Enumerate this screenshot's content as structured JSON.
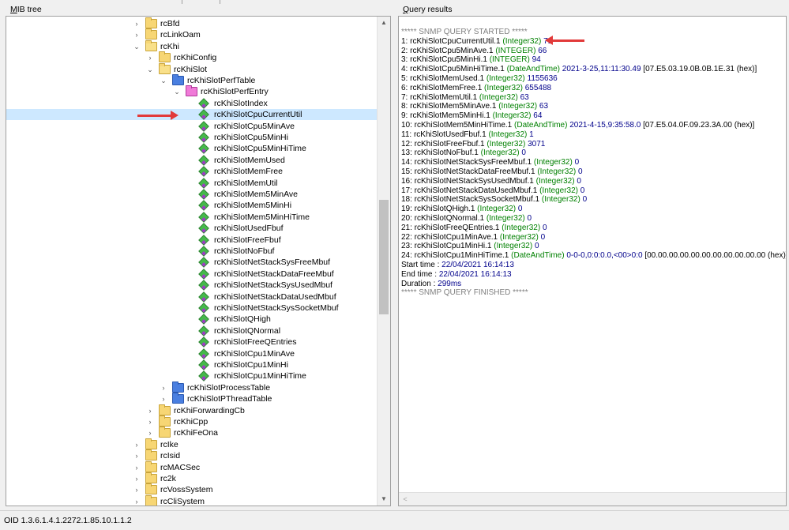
{
  "panels": {
    "mib_label": "MIB tree",
    "mib_label_accel": "M",
    "mib_label_rest": "IB tree",
    "results_label": "Query results",
    "results_label_accel": "Q",
    "results_label_rest": "uery results"
  },
  "tree": {
    "rows": [
      {
        "label": "rcBfd",
        "level": 0,
        "icon": "folder-closed",
        "expander": "collapsed"
      },
      {
        "label": "rcLinkOam",
        "level": 0,
        "icon": "folder-closed",
        "expander": "collapsed"
      },
      {
        "label": "rcKhi",
        "level": 0,
        "icon": "folder-open",
        "expander": "expanded"
      },
      {
        "label": "rcKhiConfig",
        "level": 1,
        "icon": "folder-closed",
        "expander": "collapsed"
      },
      {
        "label": "rcKhiSlot",
        "level": 1,
        "icon": "folder-open",
        "expander": "expanded"
      },
      {
        "label": "rcKhiSlotPerfTable",
        "level": 2,
        "icon": "table-folder",
        "expander": "expanded"
      },
      {
        "label": "rcKhiSlotPerfEntry",
        "level": 3,
        "icon": "entry-folder",
        "expander": "expanded"
      },
      {
        "label": "rcKhiSlotIndex",
        "level": 4,
        "icon": "leaf-object",
        "expander": "none"
      },
      {
        "label": "rcKhiSlotCpuCurrentUtil",
        "level": 4,
        "icon": "leaf-object",
        "expander": "none",
        "selected": true
      },
      {
        "label": "rcKhiSlotCpu5MinAve",
        "level": 4,
        "icon": "leaf-object",
        "expander": "none"
      },
      {
        "label": "rcKhiSlotCpu5MinHi",
        "level": 4,
        "icon": "leaf-object",
        "expander": "none"
      },
      {
        "label": "rcKhiSlotCpu5MinHiTime",
        "level": 4,
        "icon": "leaf-object",
        "expander": "none"
      },
      {
        "label": "rcKhiSlotMemUsed",
        "level": 4,
        "icon": "leaf-object",
        "expander": "none"
      },
      {
        "label": "rcKhiSlotMemFree",
        "level": 4,
        "icon": "leaf-object",
        "expander": "none"
      },
      {
        "label": "rcKhiSlotMemUtil",
        "level": 4,
        "icon": "leaf-object",
        "expander": "none"
      },
      {
        "label": "rcKhiSlotMem5MinAve",
        "level": 4,
        "icon": "leaf-object",
        "expander": "none"
      },
      {
        "label": "rcKhiSlotMem5MinHi",
        "level": 4,
        "icon": "leaf-object",
        "expander": "none"
      },
      {
        "label": "rcKhiSlotMem5MinHiTime",
        "level": 4,
        "icon": "leaf-object",
        "expander": "none"
      },
      {
        "label": "rcKhiSlotUsedFbuf",
        "level": 4,
        "icon": "leaf-object",
        "expander": "none"
      },
      {
        "label": "rcKhiSlotFreeFbuf",
        "level": 4,
        "icon": "leaf-object",
        "expander": "none"
      },
      {
        "label": "rcKhiSlotNoFbuf",
        "level": 4,
        "icon": "leaf-object",
        "expander": "none"
      },
      {
        "label": "rcKhiSlotNetStackSysFreeMbuf",
        "level": 4,
        "icon": "leaf-object",
        "expander": "none"
      },
      {
        "label": "rcKhiSlotNetStackDataFreeMbuf",
        "level": 4,
        "icon": "leaf-object",
        "expander": "none"
      },
      {
        "label": "rcKhiSlotNetStackSysUsedMbuf",
        "level": 4,
        "icon": "leaf-object",
        "expander": "none"
      },
      {
        "label": "rcKhiSlotNetStackDataUsedMbuf",
        "level": 4,
        "icon": "leaf-object",
        "expander": "none"
      },
      {
        "label": "rcKhiSlotNetStackSysSocketMbuf",
        "level": 4,
        "icon": "leaf-object",
        "expander": "none"
      },
      {
        "label": "rcKhiSlotQHigh",
        "level": 4,
        "icon": "leaf-object",
        "expander": "none"
      },
      {
        "label": "rcKhiSlotQNormal",
        "level": 4,
        "icon": "leaf-object",
        "expander": "none"
      },
      {
        "label": "rcKhiSlotFreeQEntries",
        "level": 4,
        "icon": "leaf-object",
        "expander": "none"
      },
      {
        "label": "rcKhiSlotCpu1MinAve",
        "level": 4,
        "icon": "leaf-object",
        "expander": "none"
      },
      {
        "label": "rcKhiSlotCpu1MinHi",
        "level": 4,
        "icon": "leaf-object",
        "expander": "none"
      },
      {
        "label": "rcKhiSlotCpu1MinHiTime",
        "level": 4,
        "icon": "leaf-object",
        "expander": "none"
      },
      {
        "label": "rcKhiSlotProcessTable",
        "level": 2,
        "icon": "table-folder",
        "expander": "collapsed"
      },
      {
        "label": "rcKhiSlotPThreadTable",
        "level": 2,
        "icon": "table-folder",
        "expander": "collapsed"
      },
      {
        "label": "rcKhiForwardingCb",
        "level": 1,
        "icon": "folder-closed",
        "expander": "collapsed"
      },
      {
        "label": "rcKhiCpp",
        "level": 1,
        "icon": "folder-closed",
        "expander": "collapsed"
      },
      {
        "label": "rcKhiFeOna",
        "level": 1,
        "icon": "folder-closed",
        "expander": "collapsed"
      },
      {
        "label": "rcIke",
        "level": 0,
        "icon": "folder-closed",
        "expander": "collapsed"
      },
      {
        "label": "rcIsid",
        "level": 0,
        "icon": "folder-closed",
        "expander": "collapsed"
      },
      {
        "label": "rcMACSec",
        "level": 0,
        "icon": "folder-closed",
        "expander": "collapsed"
      },
      {
        "label": "rc2k",
        "level": 0,
        "icon": "folder-closed",
        "expander": "collapsed"
      },
      {
        "label": "rcVossSystem",
        "level": 0,
        "icon": "folder-closed",
        "expander": "collapsed"
      },
      {
        "label": "rcCliSystem",
        "level": 0,
        "icon": "folder-closed",
        "expander": "collapsed"
      }
    ]
  },
  "results": {
    "started": "***** SNMP QUERY STARTED *****",
    "lines": [
      {
        "prefix": "1: rcKhiSlotCpuCurrentUtil.1",
        "type": "(Integer32)",
        "value": "71",
        "extra": ""
      },
      {
        "prefix": "2: rcKhiSlotCpu5MinAve.1",
        "type": "(INTEGER)",
        "value": "66",
        "extra": ""
      },
      {
        "prefix": "3: rcKhiSlotCpu5MinHi.1",
        "type": "(INTEGER)",
        "value": "94",
        "extra": ""
      },
      {
        "prefix": "4: rcKhiSlotCpu5MinHiTime.1",
        "type": "(DateAndTime)",
        "value": "2021-3-25,11:11:30.49",
        "extra": "[07.E5.03.19.0B.0B.1E.31 (hex)]"
      },
      {
        "prefix": "5: rcKhiSlotMemUsed.1",
        "type": "(Integer32)",
        "value": "1155636",
        "extra": ""
      },
      {
        "prefix": "6: rcKhiSlotMemFree.1",
        "type": "(Integer32)",
        "value": "655488",
        "extra": ""
      },
      {
        "prefix": "7: rcKhiSlotMemUtil.1",
        "type": "(Integer32)",
        "value": "63",
        "extra": ""
      },
      {
        "prefix": "8: rcKhiSlotMem5MinAve.1",
        "type": "(Integer32)",
        "value": "63",
        "extra": ""
      },
      {
        "prefix": "9: rcKhiSlotMem5MinHi.1",
        "type": "(Integer32)",
        "value": "64",
        "extra": ""
      },
      {
        "prefix": "10: rcKhiSlotMem5MinHiTime.1",
        "type": "(DateAndTime)",
        "value": "2021-4-15,9:35:58.0",
        "extra": "[07.E5.04.0F.09.23.3A.00 (hex)]"
      },
      {
        "prefix": "11: rcKhiSlotUsedFbuf.1",
        "type": "(Integer32)",
        "value": "1",
        "extra": ""
      },
      {
        "prefix": "12: rcKhiSlotFreeFbuf.1",
        "type": "(Integer32)",
        "value": "3071",
        "extra": ""
      },
      {
        "prefix": "13: rcKhiSlotNoFbuf.1",
        "type": "(Integer32)",
        "value": "0",
        "extra": ""
      },
      {
        "prefix": "14: rcKhiSlotNetStackSysFreeMbuf.1",
        "type": "(Integer32)",
        "value": "0",
        "extra": ""
      },
      {
        "prefix": "15: rcKhiSlotNetStackDataFreeMbuf.1",
        "type": "(Integer32)",
        "value": "0",
        "extra": ""
      },
      {
        "prefix": "16: rcKhiSlotNetStackSysUsedMbuf.1",
        "type": "(Integer32)",
        "value": "0",
        "extra": ""
      },
      {
        "prefix": "17: rcKhiSlotNetStackDataUsedMbuf.1",
        "type": "(Integer32)",
        "value": "0",
        "extra": ""
      },
      {
        "prefix": "18: rcKhiSlotNetStackSysSocketMbuf.1",
        "type": "(Integer32)",
        "value": "0",
        "extra": ""
      },
      {
        "prefix": "19: rcKhiSlotQHigh.1",
        "type": "(Integer32)",
        "value": "0",
        "extra": ""
      },
      {
        "prefix": "20: rcKhiSlotQNormal.1",
        "type": "(Integer32)",
        "value": "0",
        "extra": ""
      },
      {
        "prefix": "21: rcKhiSlotFreeQEntries.1",
        "type": "(Integer32)",
        "value": "0",
        "extra": ""
      },
      {
        "prefix": "22: rcKhiSlotCpu1MinAve.1",
        "type": "(Integer32)",
        "value": "0",
        "extra": ""
      },
      {
        "prefix": "23: rcKhiSlotCpu1MinHi.1",
        "type": "(Integer32)",
        "value": "0",
        "extra": ""
      },
      {
        "prefix": "24: rcKhiSlotCpu1MinHiTime.1",
        "type": "(DateAndTime)",
        "value": "0-0-0,0:0:0.0,<00>0:0",
        "extra": "[00.00.00.00.00.00.00.00.00.00.00 (hex)]"
      }
    ],
    "start_label": "Start time :",
    "start_value": "22/04/2021 16:14:13",
    "end_label": "End time :",
    "end_value": "22/04/2021 16:14:13",
    "duration_label": "Duration :",
    "duration_value": "299ms",
    "finished": "***** SNMP QUERY FINISHED *****"
  },
  "status": {
    "oid_text": "OID 1.3.6.1.4.1.2272.1.85.10.1.1.2"
  },
  "icons": {
    "expand": "chevron-right-icon",
    "collapse": "chevron-down-icon",
    "folder": "folder-icon",
    "leaf": "mib-object-icon"
  },
  "colors": {
    "annotation_arrow": "#e23a3a",
    "selection": "#cde8ff",
    "type_text": "#008000",
    "value_text": "#00008b",
    "marker_text": "#808080"
  }
}
